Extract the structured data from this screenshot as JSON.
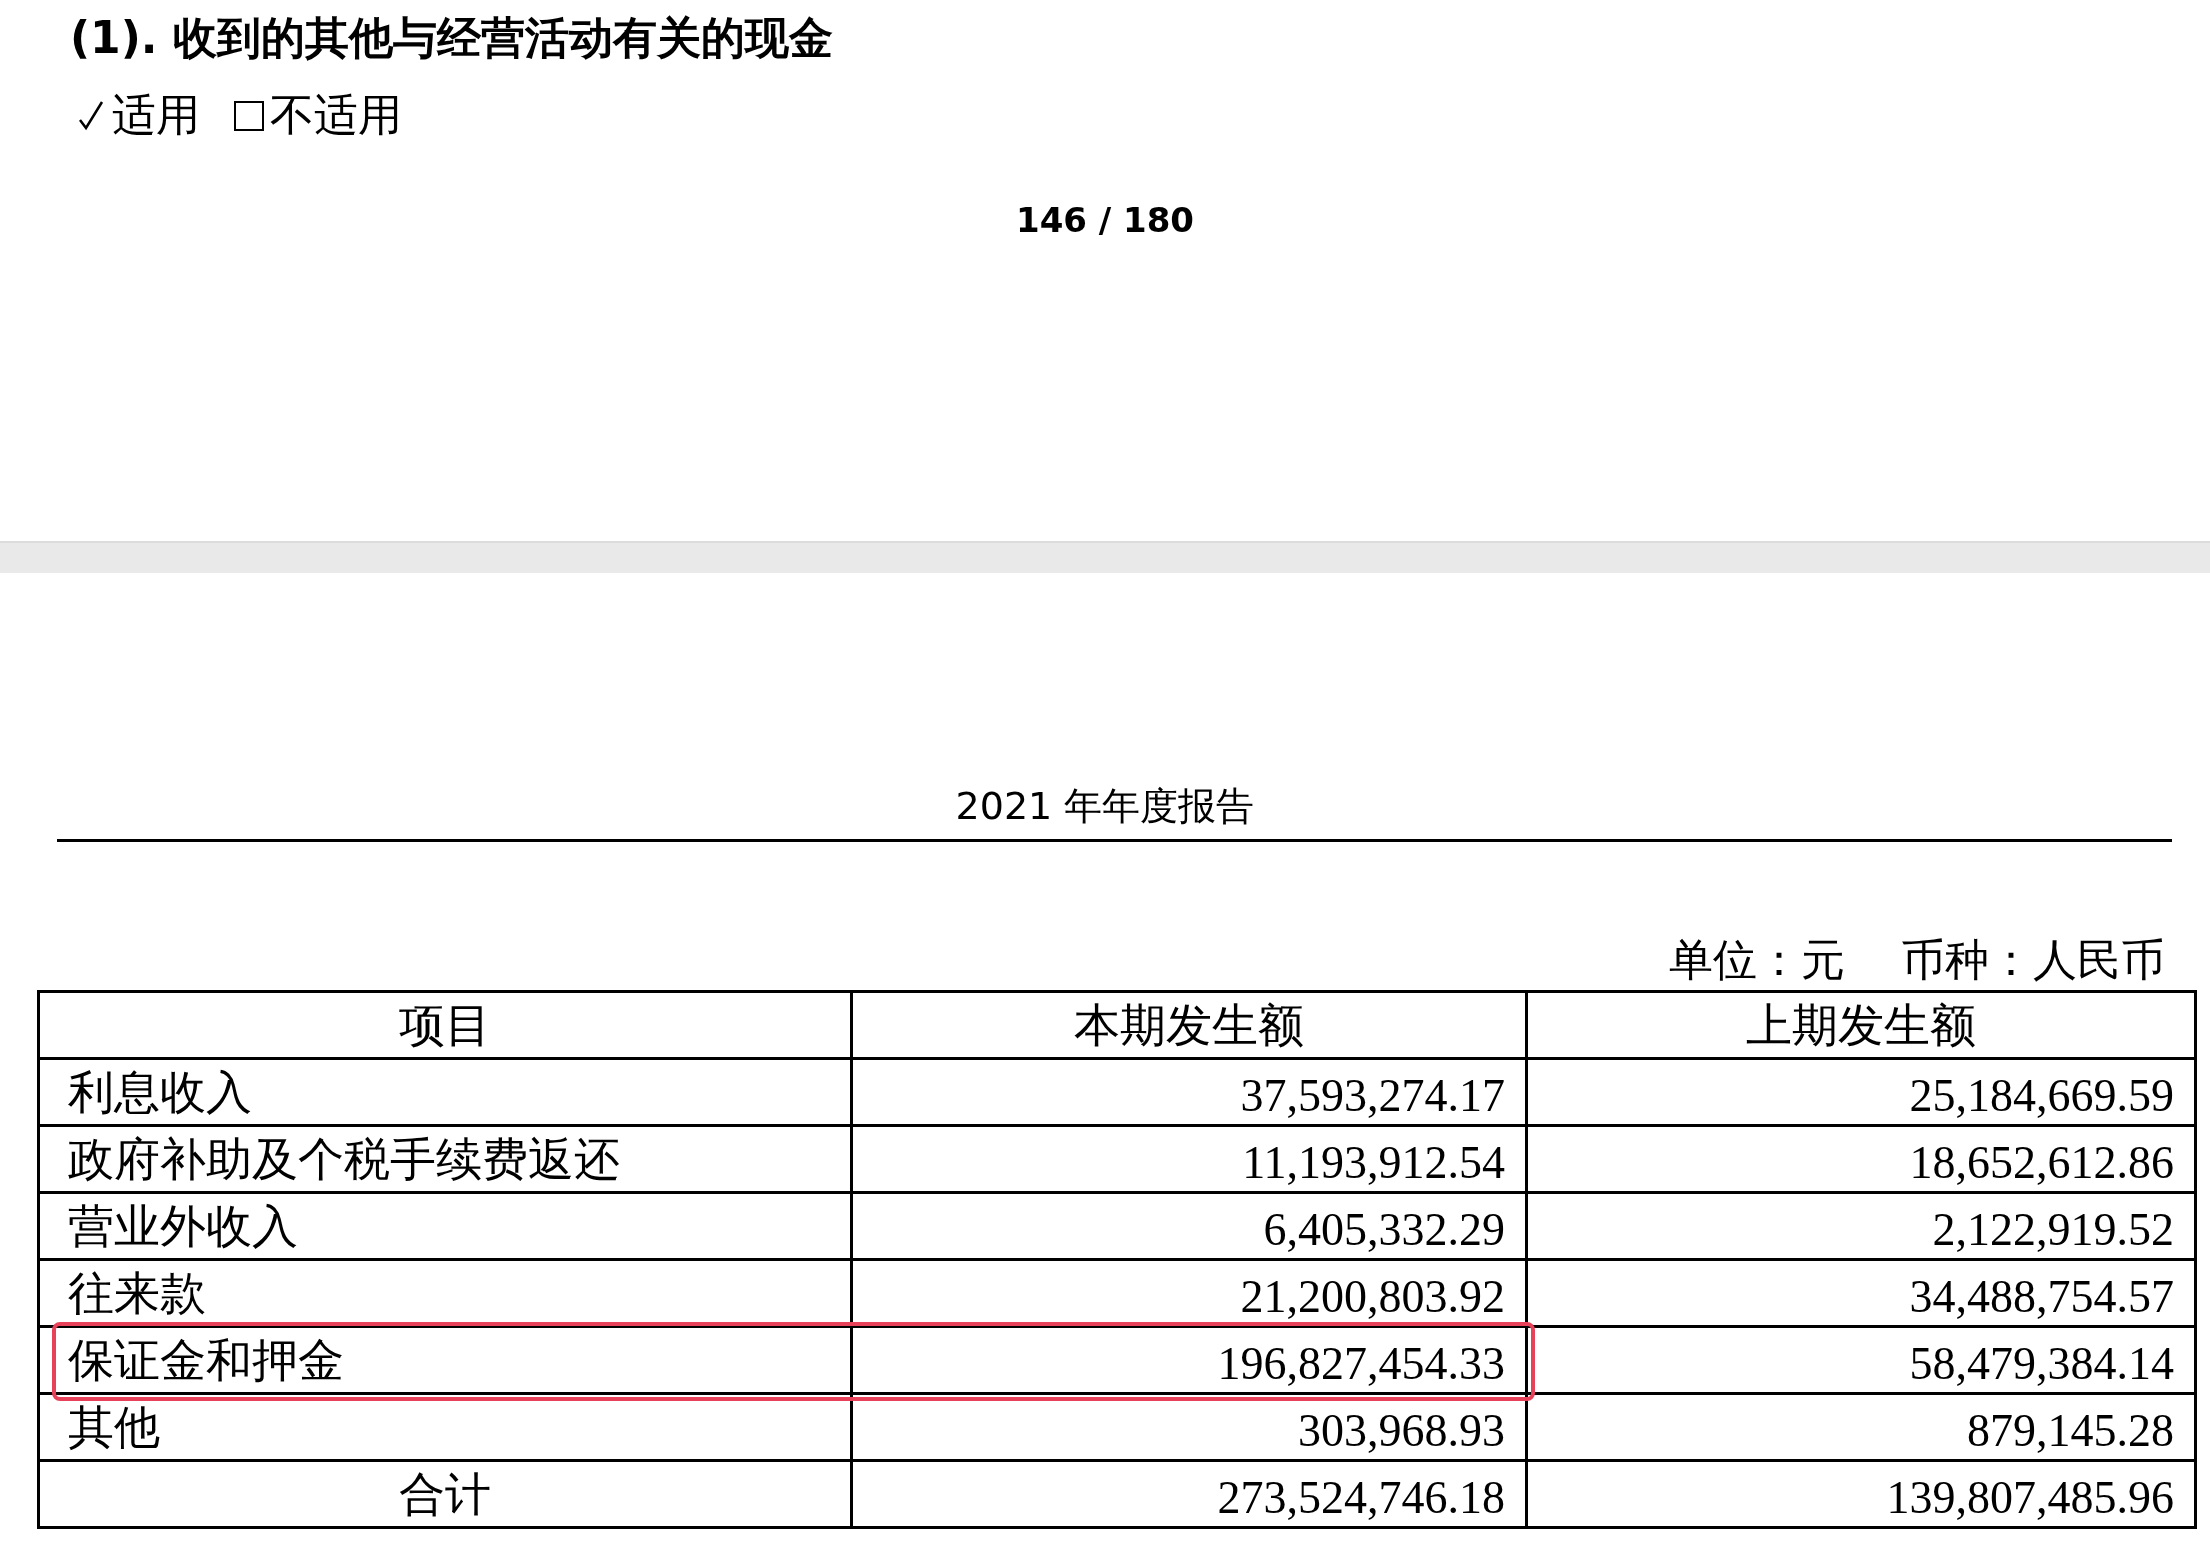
{
  "page_1": {
    "heading": "(1). 收到的其他与经营活动有关的现金",
    "options": [
      {
        "label": "适用",
        "checked": true
      },
      {
        "label": "不适用",
        "checked": false
      }
    ],
    "page_number": "146 / 180"
  },
  "page_2": {
    "running_header": "2021 年年度报告",
    "unit_note": [
      "单位：元",
      "币种：人民币"
    ],
    "table": {
      "columns": [
        "项目",
        "本期发生额",
        "上期发生额"
      ],
      "rows": [
        {
          "kind": "item",
          "highlighted": false,
          "cells": [
            "利息收入",
            "37,593,274.17",
            "25,184,669.59"
          ]
        },
        {
          "kind": "item",
          "highlighted": false,
          "cells": [
            "政府补助及个税手续费返还",
            "11,193,912.54",
            "18,652,612.86"
          ]
        },
        {
          "kind": "item",
          "highlighted": false,
          "cells": [
            "营业外收入",
            "6,405,332.29",
            "2,122,919.52"
          ]
        },
        {
          "kind": "item",
          "highlighted": false,
          "cells": [
            "往来款",
            "21,200,803.92",
            "34,488,754.57"
          ]
        },
        {
          "kind": "item",
          "highlighted": true,
          "cells": [
            "保证金和押金",
            "196,827,454.33",
            "58,479,384.14"
          ]
        },
        {
          "kind": "item",
          "highlighted": false,
          "cells": [
            "其他",
            "303,968.93",
            "879,145.28"
          ]
        },
        {
          "kind": "total",
          "highlighted": false,
          "cells": [
            "合计",
            "273,524,746.18",
            "139,807,485.96"
          ]
        }
      ]
    }
  }
}
